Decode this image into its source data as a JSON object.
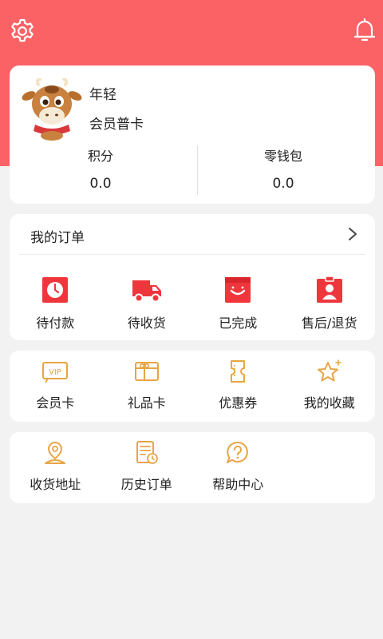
{
  "profile": {
    "name": "年轻",
    "member_level": "会员普卡",
    "points_label": "积分",
    "points_value": "0.0",
    "wallet_label": "零钱包",
    "wallet_value": "0.0"
  },
  "orders": {
    "title": "我的订单",
    "items": [
      {
        "label": "待付款",
        "icon": "pending-payment-icon"
      },
      {
        "label": "待收货",
        "icon": "delivery-truck-icon"
      },
      {
        "label": "已完成",
        "icon": "completed-smile-icon"
      },
      {
        "label": "售后/退货",
        "icon": "after-sales-icon"
      }
    ]
  },
  "services": {
    "items": [
      {
        "label": "会员卡",
        "icon": "vip-card-icon",
        "badge": "VIP"
      },
      {
        "label": "礼品卡",
        "icon": "gift-card-icon"
      },
      {
        "label": "优惠券",
        "icon": "coupon-icon"
      },
      {
        "label": "我的收藏",
        "icon": "favorite-star-icon"
      }
    ]
  },
  "tools": {
    "items": [
      {
        "label": "收货地址",
        "icon": "address-icon"
      },
      {
        "label": "历史订单",
        "icon": "order-history-icon"
      },
      {
        "label": "帮助中心",
        "icon": "help-icon"
      }
    ]
  },
  "colors": {
    "brand": "#fa6266",
    "order_icon": "#f0363d",
    "service_icon": "#e8a545"
  }
}
